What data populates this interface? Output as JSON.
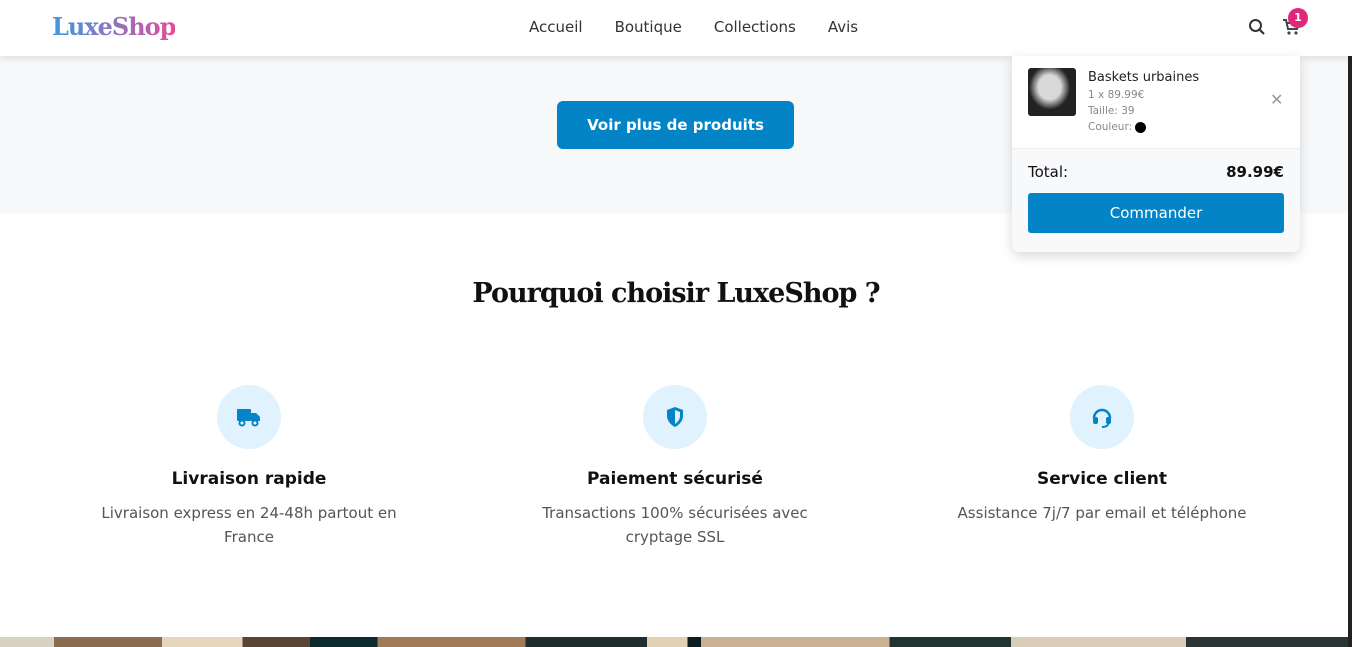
{
  "header": {
    "logo": "LuxeShop",
    "nav": [
      "Accueil",
      "Boutique",
      "Collections",
      "Avis"
    ],
    "cart_count": "1"
  },
  "products": {
    "more_label": "Voir plus de produits"
  },
  "why": {
    "title": "Pourquoi choisir LuxeShop ?",
    "features": [
      {
        "icon": "truck-icon",
        "title": "Livraison rapide",
        "text": "Livraison express en 24-48h partout en France"
      },
      {
        "icon": "shield-icon",
        "title": "Paiement sécurisé",
        "text": "Transactions 100% sécurisées avec cryptage SSL"
      },
      {
        "icon": "headset-icon",
        "title": "Service client",
        "text": "Assistance 7j/7 par email et téléphone"
      }
    ]
  },
  "cart": {
    "item": {
      "name": "Baskets urbaines",
      "qty_price": "1 x 89.99€",
      "size": "Taille: 39",
      "color_label": "Couleur:",
      "color": "#000000"
    },
    "total_label": "Total:",
    "total": "89.99€",
    "checkout": "Commander"
  },
  "colors": {
    "accent": "#0284c7",
    "badge": "#e0277a"
  }
}
